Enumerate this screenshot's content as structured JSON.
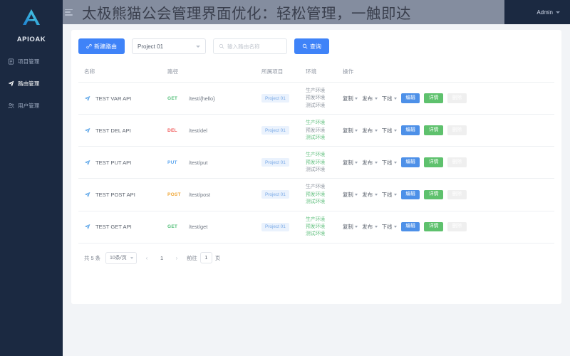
{
  "overlay": {
    "title": "太极熊猫公会管理界面优化：轻松管理，一触即达"
  },
  "sidebar": {
    "brand": "APIOAK",
    "items": [
      {
        "label": "项目管理",
        "icon": "document-icon",
        "active": false
      },
      {
        "label": "路由管理",
        "icon": "paper-plane-icon",
        "active": true
      },
      {
        "label": "用户管理",
        "icon": "user-group-icon",
        "active": false
      }
    ]
  },
  "topbar": {
    "menu_icon": "hamburger-icon",
    "user": "Admin",
    "caret": "chevron-down-icon"
  },
  "toolbar": {
    "new_route_label": "新建路由",
    "new_route_icon": "plus-link-icon",
    "project_select_value": "Project 01",
    "search_placeholder": "输入路由名称",
    "search_value": "",
    "search_icon": "search-icon",
    "search_button_label": "查询",
    "search_button_icon": "search-icon"
  },
  "table": {
    "headers": [
      "名称",
      "路径",
      "所属项目",
      "环境",
      "操作"
    ],
    "rows": [
      {
        "name": "TEST VAR API",
        "method": "GET",
        "method_color": "#58c27d",
        "path": "/test/{hello}",
        "project": "Project 01",
        "environments": [
          {
            "label": "生产环境",
            "enabled": false
          },
          {
            "label": "预发环境",
            "enabled": false
          },
          {
            "label": "测试环境",
            "enabled": false
          }
        ]
      },
      {
        "name": "TEST DEL API",
        "method": "DEL",
        "method_color": "#f15b5b",
        "path": "/test/del",
        "project": "Project 01",
        "environments": [
          {
            "label": "生产环境",
            "enabled": true
          },
          {
            "label": "预发环境",
            "enabled": false
          },
          {
            "label": "测试环境",
            "enabled": true
          }
        ]
      },
      {
        "name": "TEST PUT API",
        "method": "PUT",
        "method_color": "#63aaf0",
        "path": "/test/put",
        "project": "Project 01",
        "environments": [
          {
            "label": "生产环境",
            "enabled": true
          },
          {
            "label": "预发环境",
            "enabled": true
          },
          {
            "label": "测试环境",
            "enabled": false
          }
        ]
      },
      {
        "name": "TEST POST API",
        "method": "POST",
        "method_color": "#f0a93c",
        "path": "/test/post",
        "project": "Project 01",
        "environments": [
          {
            "label": "生产环境",
            "enabled": false
          },
          {
            "label": "预发环境",
            "enabled": true
          },
          {
            "label": "测试环境",
            "enabled": true
          }
        ]
      },
      {
        "name": "TEST GET API",
        "method": "GET",
        "method_color": "#58c27d",
        "path": "/test/get",
        "project": "Project 01",
        "environments": [
          {
            "label": "生产环境",
            "enabled": true
          },
          {
            "label": "预发环境",
            "enabled": true
          },
          {
            "label": "测试环境",
            "enabled": true
          }
        ]
      }
    ],
    "row_actions": {
      "dropdowns": [
        "复制",
        "发布",
        "下线"
      ],
      "buttons": [
        {
          "label": "编辑",
          "color": "#4d90e8",
          "kind": "edit"
        },
        {
          "label": "详情",
          "color": "#5ec16d",
          "kind": "detail"
        },
        {
          "label": "删除",
          "color": "#ef5f5f",
          "kind": "delete"
        }
      ]
    }
  },
  "pagination": {
    "total_text": "共 5 条",
    "page_size": "10条/页",
    "prev_icon": "chevron-left-icon",
    "next_icon": "chevron-right-icon",
    "current_page": "1",
    "jump_prefix": "前往",
    "jump_value": "1",
    "jump_suffix": "页"
  },
  "colors": {
    "sidebar_bg": "#1b2941",
    "accent": "#3f83f8",
    "content_bg": "#f2f4f7",
    "env_on": "#62c07f",
    "env_off": "#8e959f"
  }
}
